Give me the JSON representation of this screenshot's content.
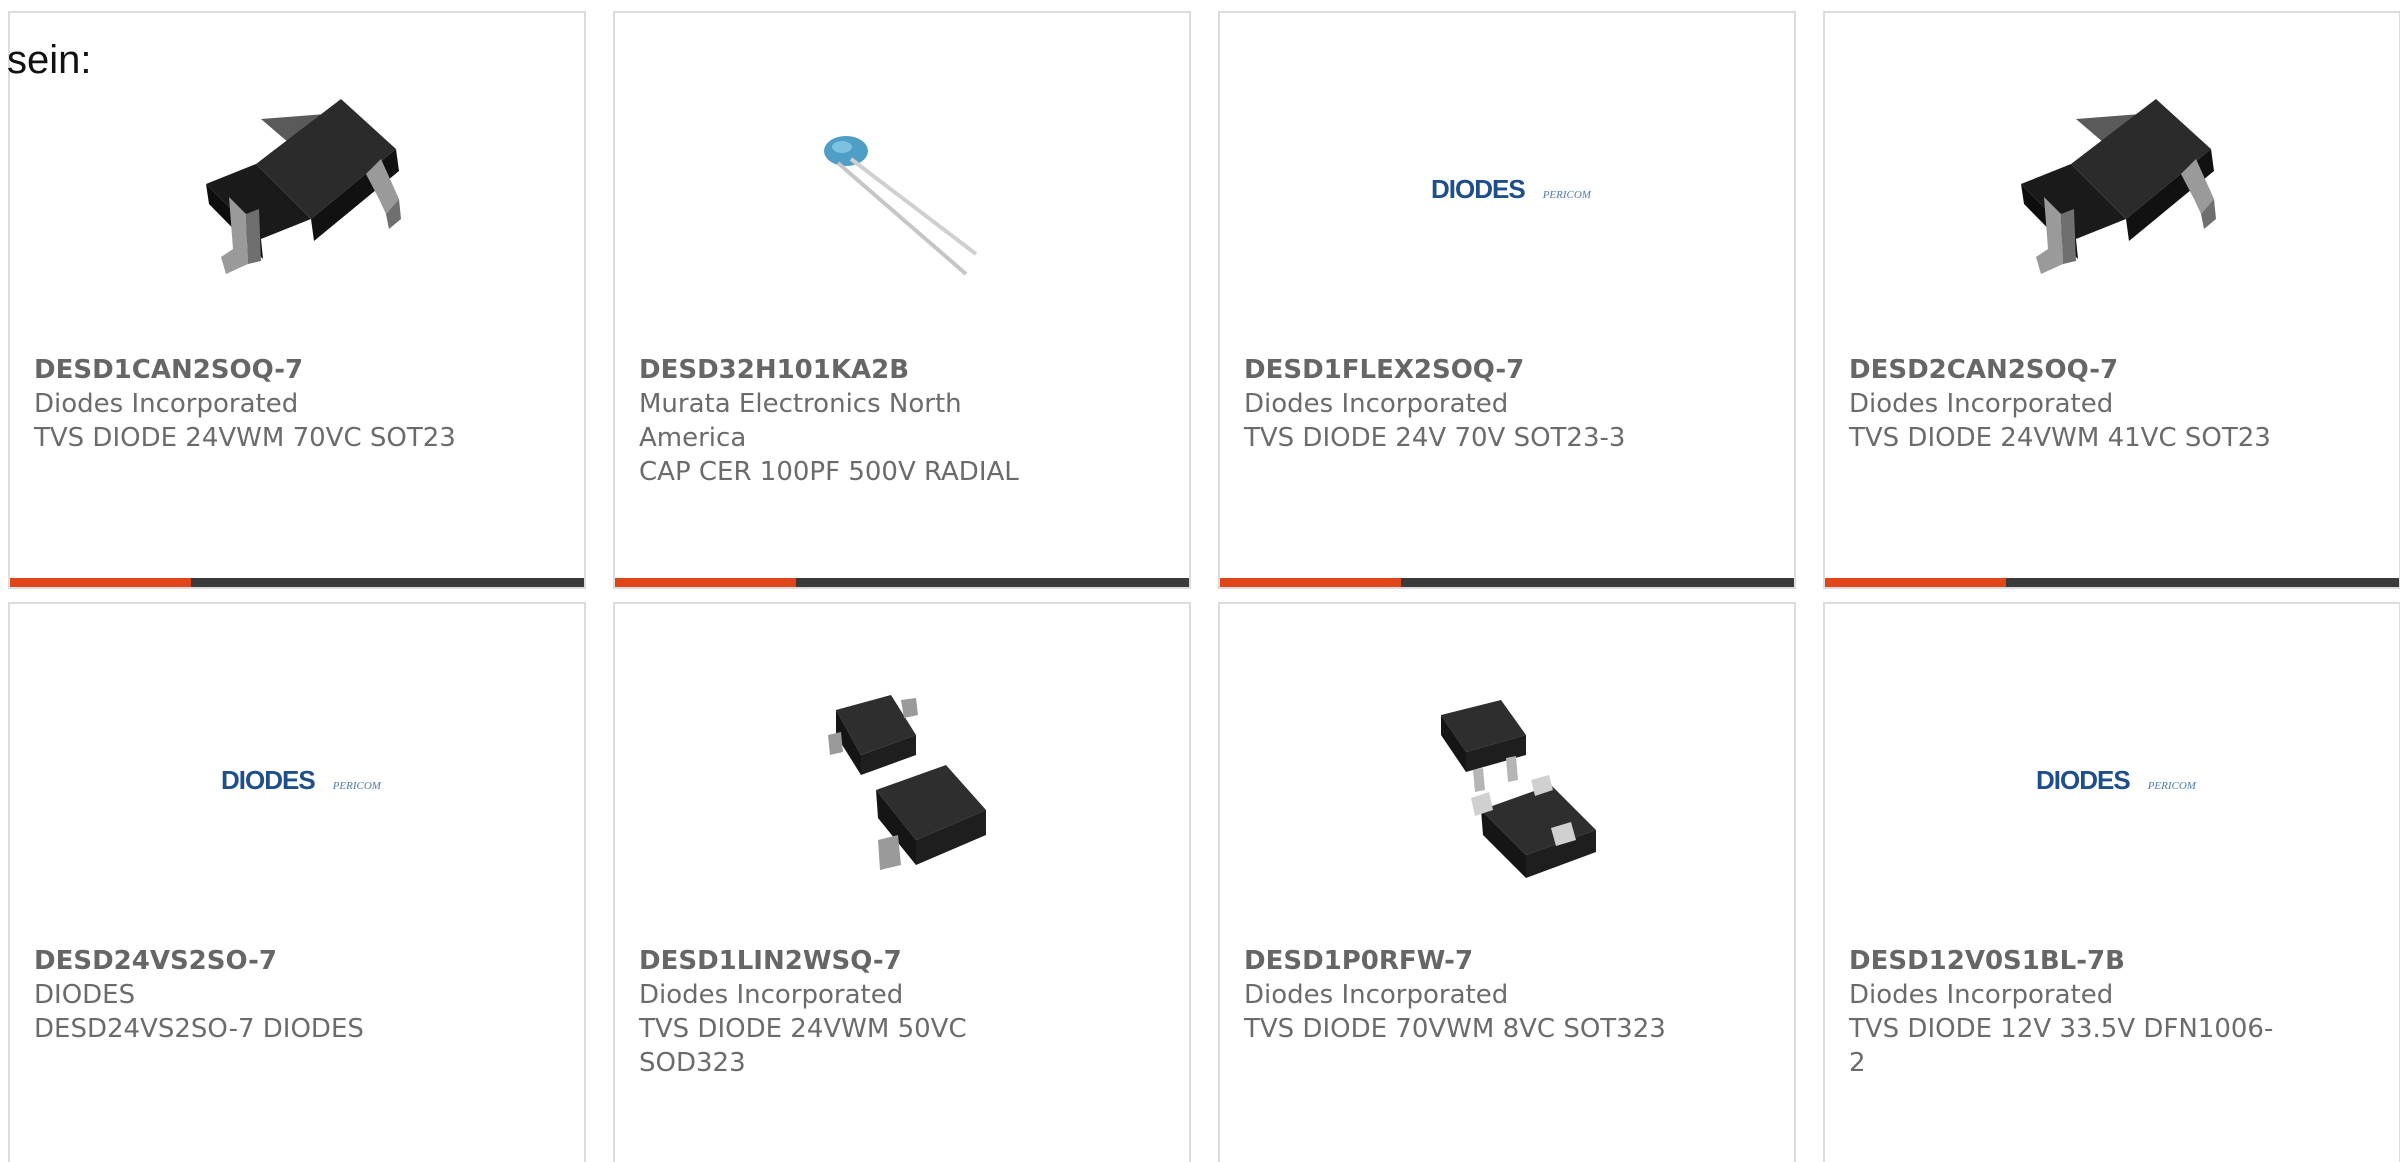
{
  "intro_text": "sein:",
  "accent_color": "#e0461a",
  "bar_color": "#3a3a3a",
  "cards": [
    {
      "part_number": "DESD1CAN2SOQ-7",
      "manufacturer": "Diodes Incorporated",
      "description": "TVS DIODE 24VWM 70VC SOT23",
      "image": "sot23-package-icon"
    },
    {
      "part_number": "DESD32H101KA2B",
      "manufacturer": "Murata Electronics North America",
      "description": "CAP CER 100PF 500V RADIAL",
      "image": "radial-ceramic-capacitor-icon"
    },
    {
      "part_number": "DESD1FLEX2SOQ-7",
      "manufacturer": "Diodes Incorporated",
      "description": "TVS DIODE 24V 70V SOT23-3",
      "image": "diodes-logo",
      "logo_main": "DIODES",
      "logo_sub": "PERICOM"
    },
    {
      "part_number": "DESD2CAN2SOQ-7",
      "manufacturer": "Diodes Incorporated",
      "description": "TVS DIODE 24VWM 41VC SOT23",
      "image": "sot23-package-icon"
    },
    {
      "part_number": "DESD24VS2SO-7",
      "manufacturer": "DIODES",
      "description": "DESD24VS2SO-7 DIODES",
      "image": "diodes-logo",
      "logo_main": "DIODES",
      "logo_sub": "PERICOM"
    },
    {
      "part_number": "DESD1LIN2WSQ-7",
      "manufacturer": "Diodes Incorporated",
      "description": "TVS DIODE 24VWM 50VC SOD323",
      "image": "sod323-package-icon"
    },
    {
      "part_number": "DESD1P0RFW-7",
      "manufacturer": "Diodes Incorporated",
      "description": "TVS DIODE 70VWM 8VC SOT323",
      "image": "sot323-package-icon"
    },
    {
      "part_number": "DESD12V0S1BL-7B",
      "manufacturer": "Diodes Incorporated",
      "description": "TVS DIODE 12V 33.5V DFN1006-2",
      "image": "diodes-logo",
      "logo_main": "DIODES",
      "logo_sub": "PERICOM"
    }
  ],
  "bar_progress": 0.315
}
